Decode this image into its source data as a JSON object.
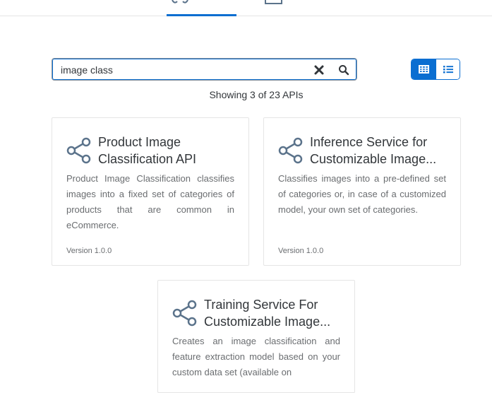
{
  "search": {
    "value": "image class",
    "placeholder": ""
  },
  "results": {
    "summary": "Showing 3 of 23 APIs"
  },
  "cards": [
    {
      "title_line1": "Product Image",
      "title_line2": "Classification API",
      "description": "Product Image Classification classifies images into a fixed set of categories of products that are common in eCommerce.",
      "version": "Version 1.0.0"
    },
    {
      "title_line1": "Inference Service for",
      "title_line2": "Customizable Image...",
      "description": "Classifies images into a pre-defined set of categories or, in case of a customized model, your own set of categories.",
      "version": "Version 1.0.0"
    },
    {
      "title_line1": "Training Service For",
      "title_line2": "Customizable Image...",
      "description": "Creates an image classification and feature extraction model based on your custom data set (available on",
      "version": ""
    }
  ],
  "colors": {
    "accent": "#0a6ed1",
    "icon": "#5b738b",
    "text": "#32363a",
    "muted": "#6a6d70"
  }
}
